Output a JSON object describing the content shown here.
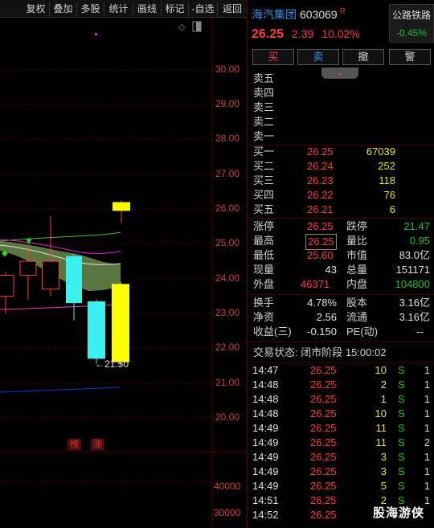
{
  "toolbar": {
    "items": [
      {
        "label": "复权"
      },
      {
        "label": "叠加"
      },
      {
        "label": "多股"
      },
      {
        "label": "统计"
      },
      {
        "label": "画线"
      },
      {
        "label": "标记"
      },
      {
        "label": "-自选"
      },
      {
        "label": "返回"
      }
    ]
  },
  "chart": {
    "price_axis": [
      "30.00",
      "29.00",
      "28.00",
      "27.00",
      "26.00",
      "25.00",
      "24.00",
      "23.00",
      "22.00",
      "21.00",
      "20.00"
    ],
    "volume_axis": [
      "40000",
      "30000"
    ],
    "low_annotation": "←21.50",
    "tags": [
      "榜",
      "涨"
    ]
  },
  "chart_data": {
    "type": "candlestick",
    "candles": [
      {
        "open": 23.5,
        "close": 24.1,
        "high": 24.2,
        "low": 23.0
      },
      {
        "open": 24.1,
        "close": 24.5,
        "high": 24.9,
        "low": 23.4
      },
      {
        "open": 23.7,
        "close": 24.5,
        "high": 25.8,
        "low": 23.5
      },
      {
        "open": 24.65,
        "close": 23.3,
        "high": 24.7,
        "low": 22.8
      },
      {
        "open": 23.35,
        "close": 21.7,
        "high": 23.4,
        "low": 21.55
      },
      {
        "open": 21.6,
        "close": 23.85,
        "high": 23.9,
        "low": 21.5
      },
      {
        "open": 26.2,
        "close": 25.95,
        "high": 26.25,
        "low": 25.6
      }
    ],
    "ylim": [
      19.5,
      30.5
    ],
    "colors": {
      "up": "#ff3b3b",
      "down": "#3cf0f0",
      "limit": "#ffff00"
    }
  },
  "stock": {
    "name": "海汽集团",
    "code": "603069",
    "flag": "R",
    "price": "26.25",
    "change": "2.39",
    "change_pct": "10.02%"
  },
  "sector": {
    "name": "公路铁路",
    "change": "-0.45%"
  },
  "trade_buttons": [
    {
      "label": "买",
      "color": "#ff3b3b"
    },
    {
      "label": "卖",
      "color": "#3a8fe0"
    },
    {
      "label": "撤",
      "color": "#d0d0d0"
    },
    {
      "label": "警",
      "color": "#d0d0d0"
    }
  ],
  "pull_tab": "⌄",
  "sell_orders": [
    {
      "label": "卖五",
      "price": "",
      "volume": ""
    },
    {
      "label": "卖四",
      "price": "",
      "volume": ""
    },
    {
      "label": "卖三",
      "price": "",
      "volume": ""
    },
    {
      "label": "卖二",
      "price": "",
      "volume": ""
    },
    {
      "label": "卖一",
      "price": "",
      "volume": ""
    }
  ],
  "buy_orders": [
    {
      "label": "买一",
      "price": "26.25",
      "volume": "67039"
    },
    {
      "label": "买二",
      "price": "26.24",
      "volume": "252"
    },
    {
      "label": "买三",
      "price": "26.23",
      "volume": "118"
    },
    {
      "label": "买四",
      "price": "26.22",
      "volume": "76"
    },
    {
      "label": "买五",
      "price": "26.21",
      "volume": "6"
    }
  ],
  "stats": [
    {
      "l1": "涨停",
      "v1": "26.25",
      "c1": "red",
      "l2": "跌停",
      "v2": "21.47",
      "c2": "green"
    },
    {
      "l1": "最高",
      "v1": "26.25",
      "c1": "red",
      "l2": "量比",
      "v2": "0.95",
      "c2": "green"
    },
    {
      "l1": "最低",
      "v1": "25.60",
      "c1": "red",
      "l2": "市值",
      "v2": "83.0亿",
      "c2": "white"
    },
    {
      "l1": "现量",
      "v1": "43",
      "c1": "white",
      "l2": "总量",
      "v2": "151171",
      "c2": "white"
    },
    {
      "l1": "外盘",
      "v1": "46371",
      "c1": "red",
      "l2": "内盘",
      "v2": "104800",
      "c2": "green"
    }
  ],
  "stats2": [
    {
      "l1": "换手",
      "v1": "4.78%",
      "l2": "股本",
      "v2": "3.16亿"
    },
    {
      "l1": "净资",
      "v1": "2.56",
      "l2": "流通",
      "v2": "3.16亿"
    },
    {
      "l1": "收益(三)",
      "v1": "-0.150",
      "l2": "PE(动)",
      "v2": "--"
    }
  ],
  "status": "交易状态: 闭市阶段 15:00:02",
  "ticks": [
    {
      "time": "14:47",
      "price": "26.25",
      "vol": "10",
      "side": "S",
      "n": "1"
    },
    {
      "time": "14:48",
      "price": "26.25",
      "vol": "2",
      "side": "S",
      "n": "1"
    },
    {
      "time": "14:48",
      "price": "26.25",
      "vol": "1",
      "side": "S",
      "n": "1"
    },
    {
      "time": "14:48",
      "price": "26.25",
      "vol": "10",
      "side": "S",
      "n": "1"
    },
    {
      "time": "14:49",
      "price": "26.25",
      "vol": "11",
      "side": "S",
      "n": "1"
    },
    {
      "time": "14:49",
      "price": "26.25",
      "vol": "11",
      "side": "S",
      "n": "2"
    },
    {
      "time": "14:49",
      "price": "26.25",
      "vol": "3",
      "side": "S",
      "n": "1"
    },
    {
      "time": "14:49",
      "price": "26.25",
      "vol": "3",
      "side": "S",
      "n": "1"
    },
    {
      "time": "14:49",
      "price": "26.25",
      "vol": "5",
      "side": "S",
      "n": "1"
    },
    {
      "time": "14:51",
      "price": "26.25",
      "vol": "2",
      "side": "S",
      "n": "1"
    },
    {
      "time": "14:52",
      "price": "26.25",
      "vol": "",
      "side": "",
      "n": ""
    }
  ],
  "watermark": "股海游侠"
}
